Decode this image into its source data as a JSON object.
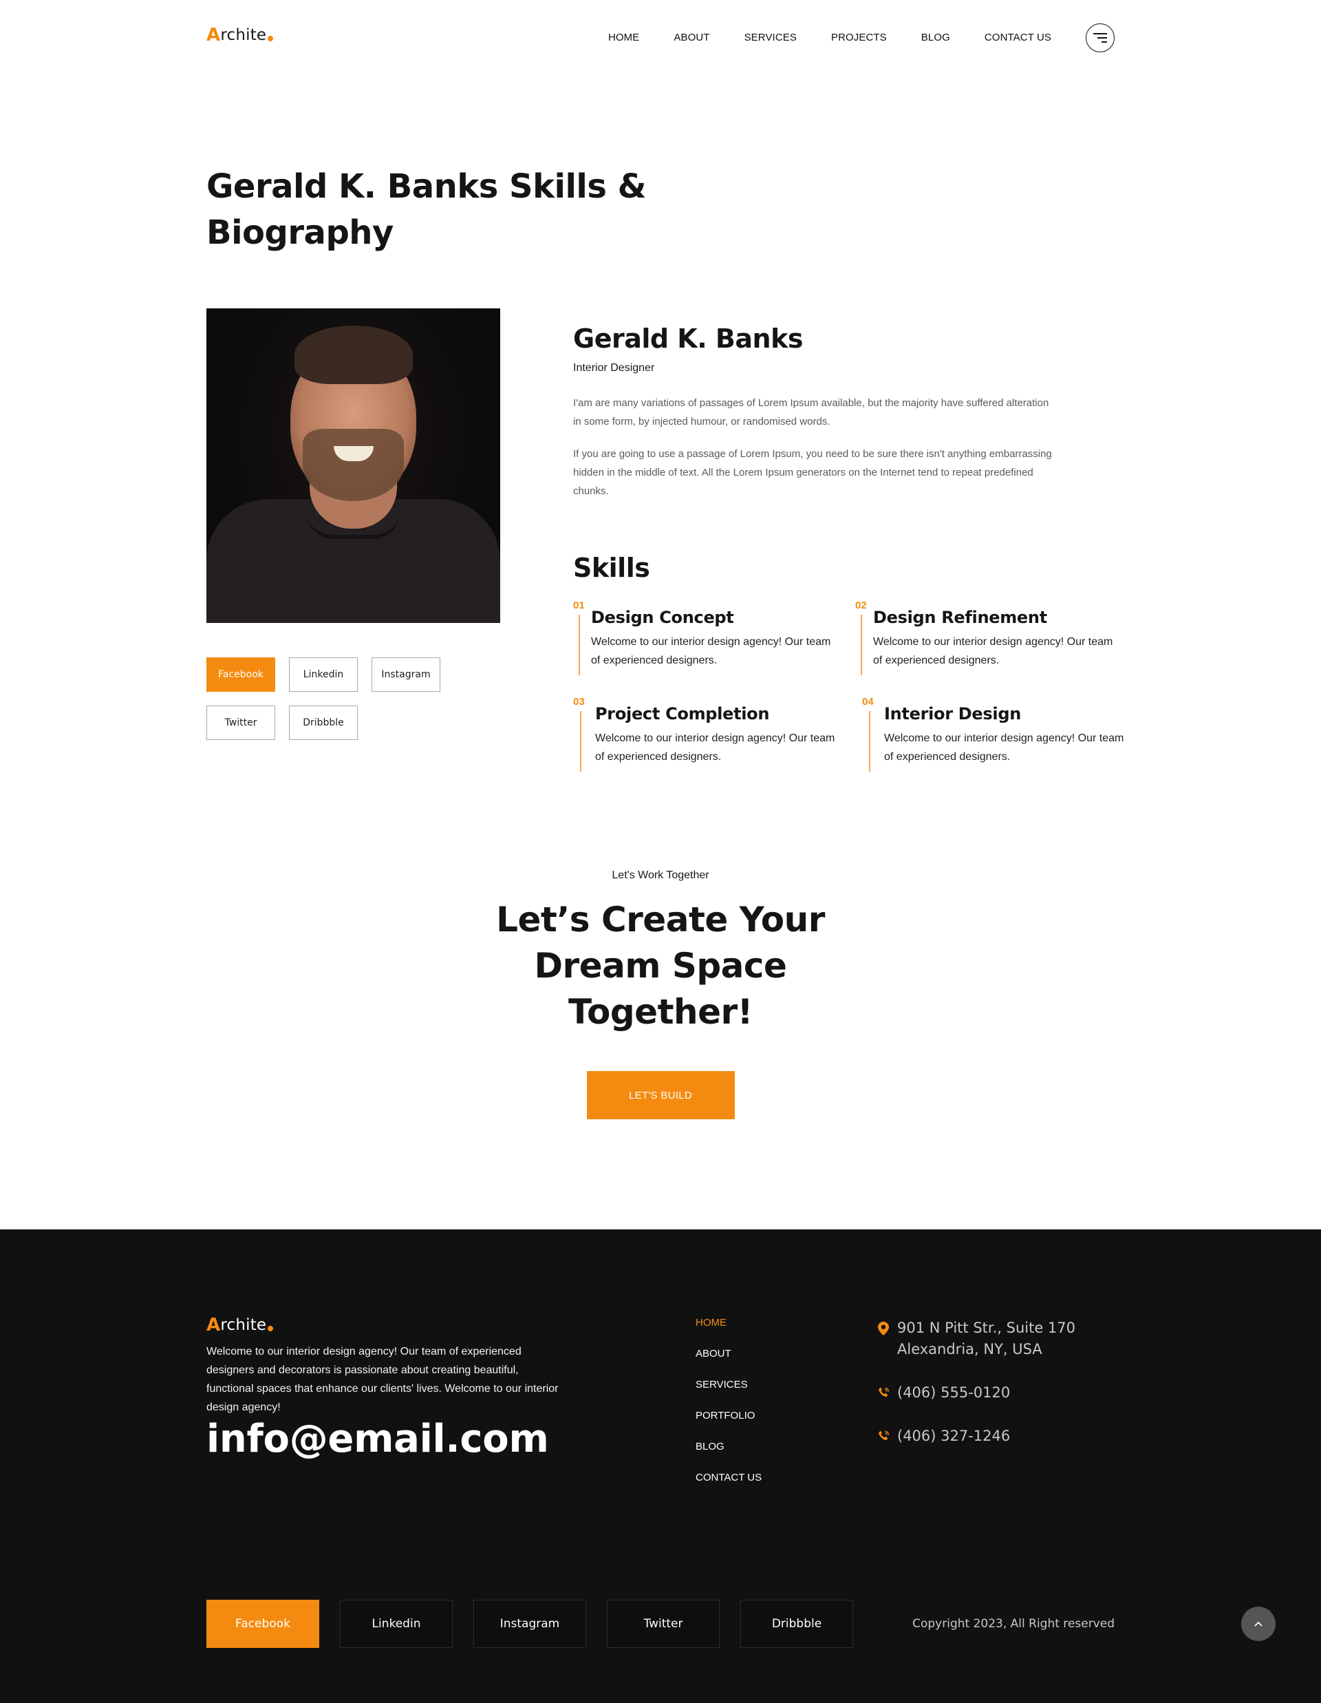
{
  "brand": {
    "logo_initial": "A",
    "logo_rest": "rchite",
    "accent_color": "#f48b10"
  },
  "nav": {
    "items": [
      {
        "label": "HOME"
      },
      {
        "label": "ABOUT"
      },
      {
        "label": "SERVICES"
      },
      {
        "label": "PROJECTS"
      },
      {
        "label": "BLOG"
      },
      {
        "label": "CONTACT US"
      }
    ],
    "menu_icon": "menu-lines-icon"
  },
  "page": {
    "title": "Gerald K. Banks Skills & Biography"
  },
  "profile": {
    "name": "Gerald K. Banks",
    "role": "Interior Designer",
    "bio": [
      "I'am are many variations of passages of Lorem Ipsum available, but the majority have suffered alteration in some form, by injected humour, or randomised words.",
      "If you are going to use a passage of Lorem Ipsum, you need to be sure there isn't anything embarrassing hidden in the middle of text. All the Lorem Ipsum generators on the Internet tend to repeat predefined chunks."
    ],
    "social": [
      {
        "label": "Facebook",
        "active": true
      },
      {
        "label": "Linkedin",
        "active": false
      },
      {
        "label": "Instagram",
        "active": false
      },
      {
        "label": "Twitter",
        "active": false
      },
      {
        "label": "Dribbble",
        "active": false
      }
    ]
  },
  "skills": {
    "title": "Skills",
    "items": [
      {
        "num": "01",
        "name": "Design Concept",
        "desc": "Welcome to our interior design agency! Our team of experienced designers."
      },
      {
        "num": "02",
        "name": "Design Refinement",
        "desc": "Welcome to our interior design agency! Our team of experienced designers."
      },
      {
        "num": "03",
        "name": "Project Completion",
        "desc": "Welcome to our interior design agency! Our team of experienced designers."
      },
      {
        "num": "04",
        "name": "Interior Design",
        "desc": "Welcome to our interior design agency! Our team of experienced designers."
      }
    ]
  },
  "cta": {
    "kicker": "Let's Work Together",
    "title": "Let’s Create Your Dream Space Together!",
    "button": "LET'S BUILD"
  },
  "footer": {
    "description": "Welcome to our interior design agency! Our team of experienced designers and decorators is passionate about creating beautiful, functional spaces that enhance our clients' lives. Welcome to our interior design agency!",
    "email": "info@email.com",
    "links": [
      {
        "label": "HOME",
        "active": true
      },
      {
        "label": "ABOUT",
        "active": false
      },
      {
        "label": "SERVICES",
        "active": false
      },
      {
        "label": "PORTFOLIO",
        "active": false
      },
      {
        "label": "BLOG",
        "active": false
      },
      {
        "label": "CONTACT US",
        "active": false
      }
    ],
    "address_line1": "901 N Pitt Str., Suite 170",
    "address_line2": "Alexandria, NY, USA",
    "phone1": "(406) 555-0120",
    "phone2": "(406) 327-1246",
    "social": [
      {
        "label": "Facebook",
        "active": true
      },
      {
        "label": "Linkedin",
        "active": false
      },
      {
        "label": "Instagram",
        "active": false
      },
      {
        "label": "Twitter",
        "active": false
      },
      {
        "label": "Dribbble",
        "active": false
      }
    ],
    "copyright": "Copyright 2023, All Right reserved",
    "back_to_top_icon": "chevron-up-icon"
  }
}
